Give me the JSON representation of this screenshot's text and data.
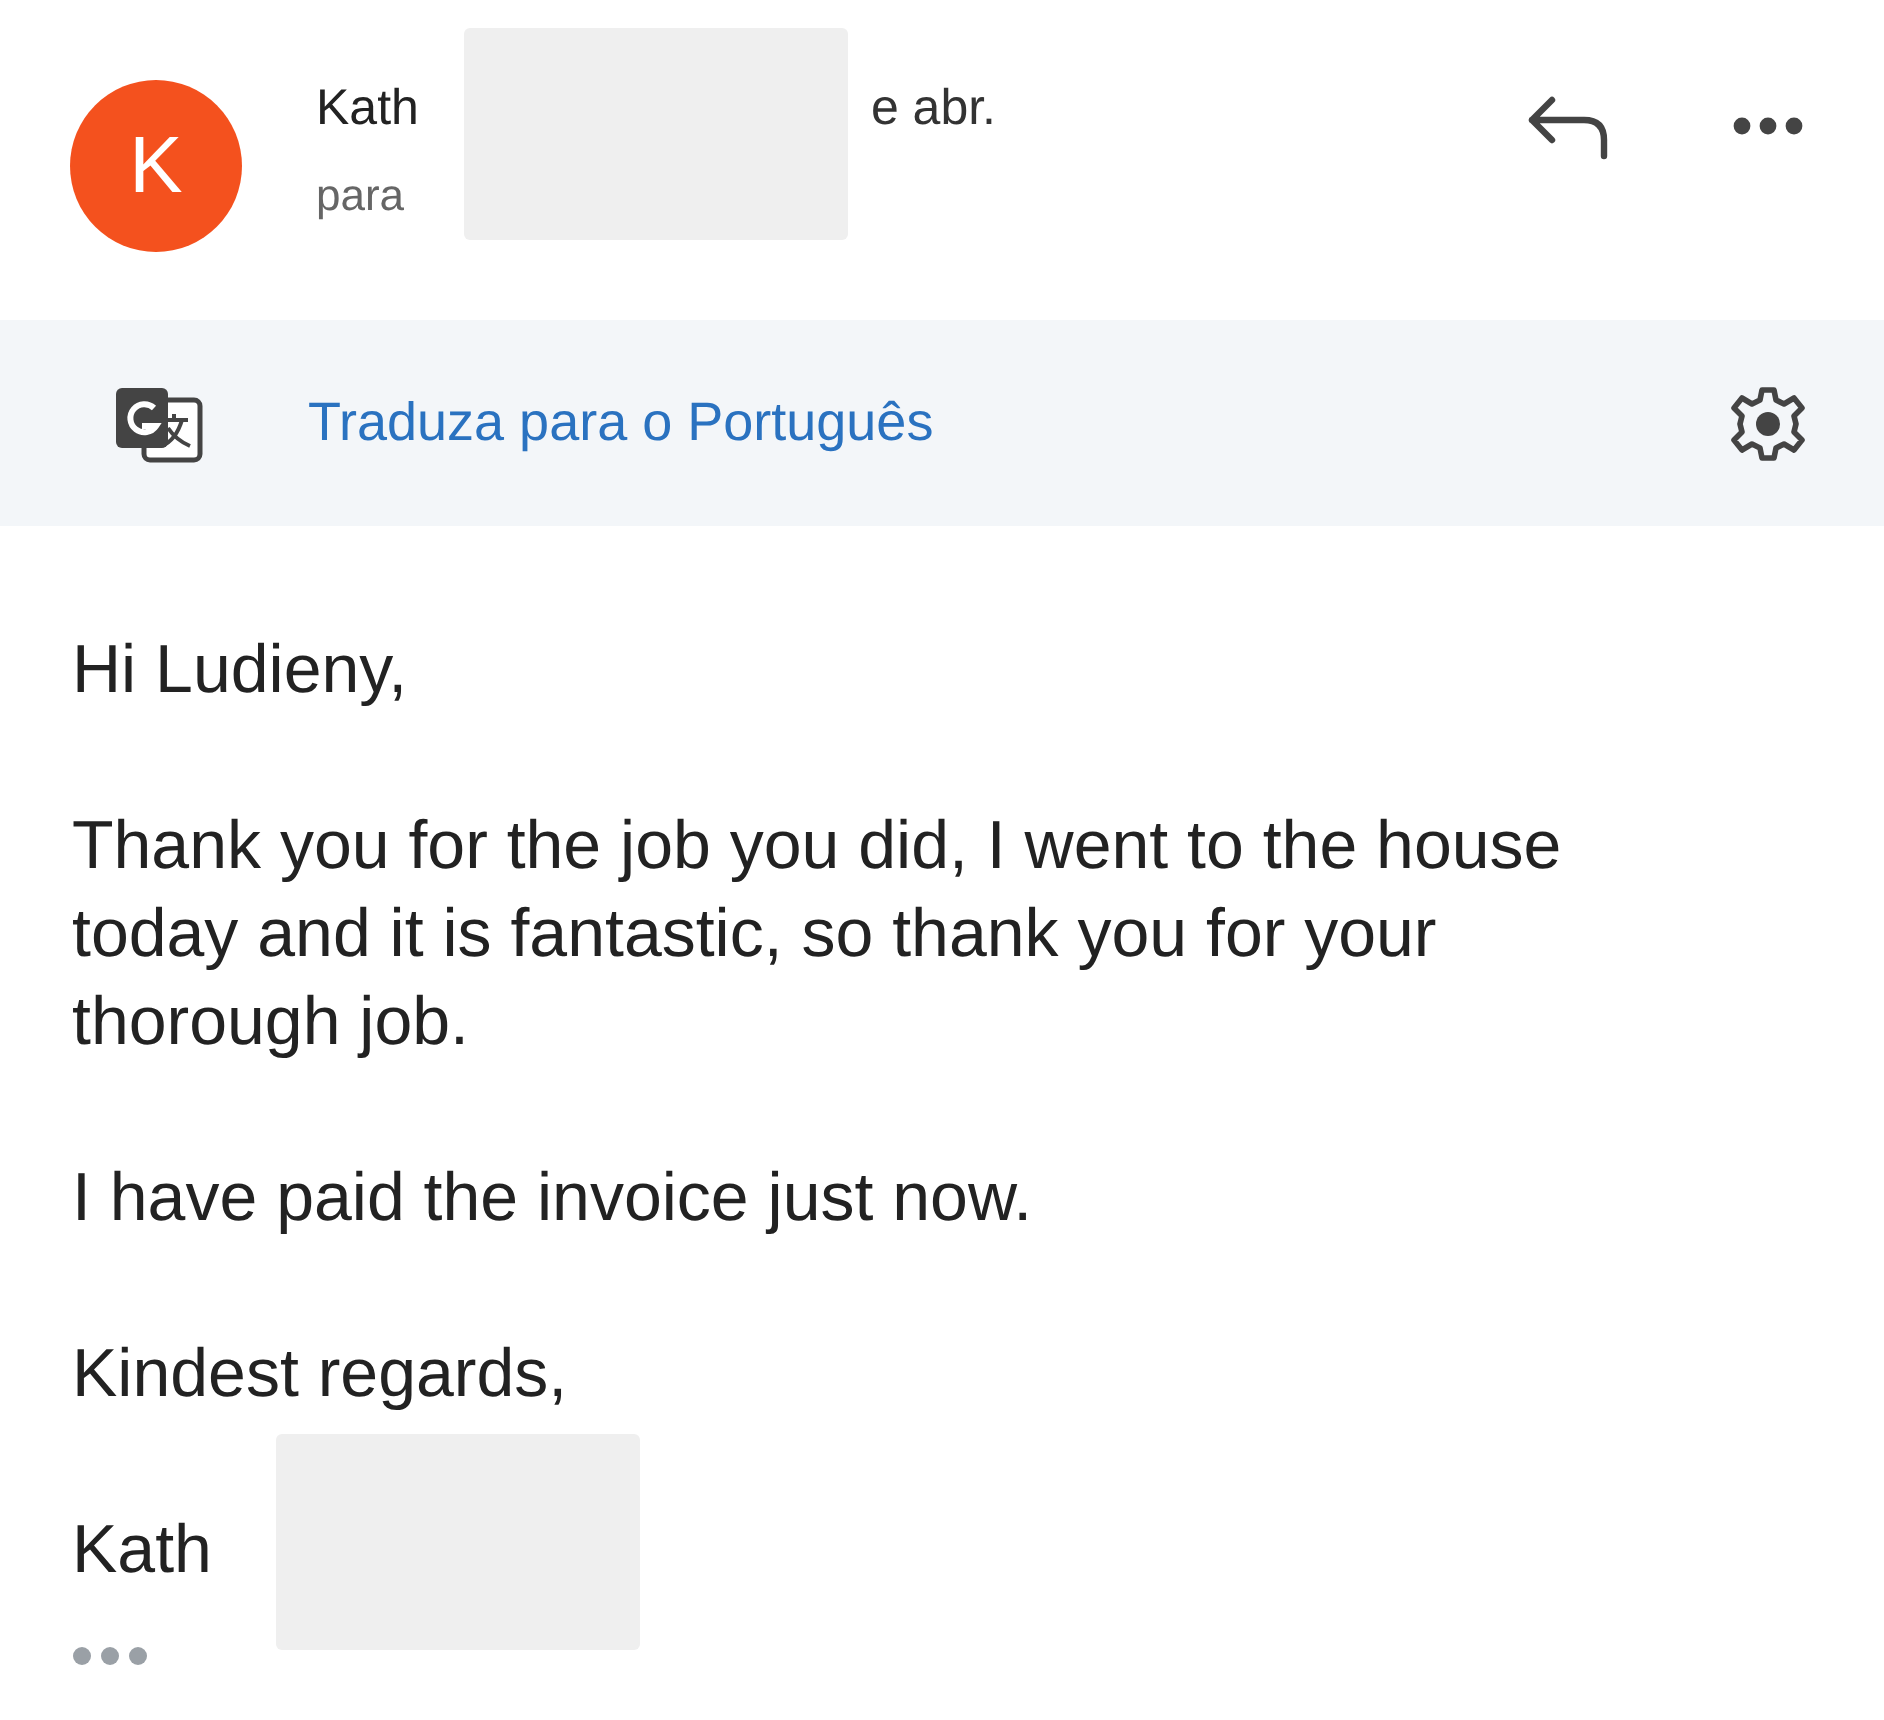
{
  "sender": {
    "avatar_letter": "K",
    "name": "Kath",
    "date": "e abr.",
    "recipient_label": "para"
  },
  "translate_bar": {
    "link": "Traduza para o Português"
  },
  "body": {
    "greeting": "Hi Ludieny,",
    "paragraphs": [
      "Thank you for the job you did, I went to the house today and it is fantastic, so thank you for your thorough job.",
      "I have paid the invoice just now.",
      "Kindest regards,"
    ],
    "signature": "Kath"
  }
}
